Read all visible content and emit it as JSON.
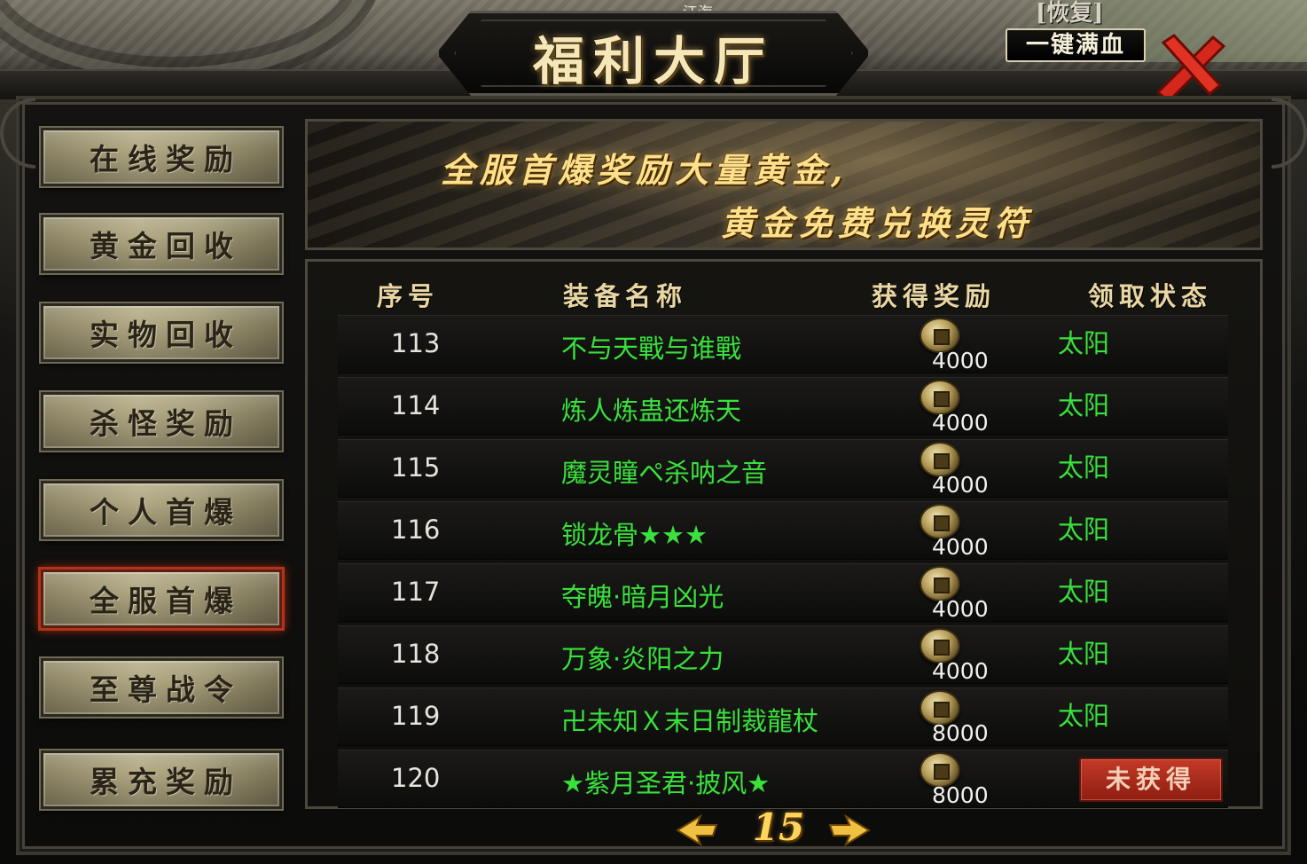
{
  "header": {
    "map_name": "江海",
    "title": "福利大厅",
    "restore_label": "[恢复]",
    "heal_button": "一键满血"
  },
  "sidebar": {
    "items": [
      {
        "label": "在线奖励",
        "active": false
      },
      {
        "label": "黄金回收",
        "active": false
      },
      {
        "label": "实物回收",
        "active": false
      },
      {
        "label": "杀怪奖励",
        "active": false
      },
      {
        "label": "个人首爆",
        "active": false
      },
      {
        "label": "全服首爆",
        "active": true
      },
      {
        "label": "至尊战令",
        "active": false
      },
      {
        "label": "累充奖励",
        "active": false
      }
    ]
  },
  "banner": {
    "line1": "全服首爆奖励大量黄金,",
    "line2": "黄金免费兑换灵符"
  },
  "table": {
    "columns": [
      "序号",
      "装备名称",
      "获得奖励",
      "领取状态"
    ],
    "rows": [
      {
        "no": "113",
        "name": "不与天戰与谁戰",
        "reward": "4000",
        "status": "太阳"
      },
      {
        "no": "114",
        "name": "炼人炼蛊还炼天",
        "reward": "4000",
        "status": "太阳"
      },
      {
        "no": "115",
        "name": "魔灵瞳ペ杀呐之音",
        "reward": "4000",
        "status": "太阳"
      },
      {
        "no": "116",
        "name": "锁龙骨★★★",
        "reward": "4000",
        "status": "太阳"
      },
      {
        "no": "117",
        "name": "夺魄·暗月凶光",
        "reward": "4000",
        "status": "太阳"
      },
      {
        "no": "118",
        "name": "万象·炎阳之力",
        "reward": "4000",
        "status": "太阳"
      },
      {
        "no": "119",
        "name": "卍未知Ｘ末日制裁龍杖",
        "reward": "8000",
        "status": "太阳"
      },
      {
        "no": "120",
        "name": "★紫月圣君·披风★",
        "reward": "8000",
        "status": "未获得"
      }
    ]
  },
  "pager": {
    "page": "15"
  },
  "colors": {
    "item_name": "#39e13c",
    "status_claimed": "#39e13c",
    "unobtained_button": "#b2301f",
    "title_gold": "#ffe08a"
  },
  "icons": {
    "reward": "coin-icon",
    "close": "close-x-icon",
    "prev": "arrow-left-icon",
    "next": "arrow-right-icon"
  }
}
